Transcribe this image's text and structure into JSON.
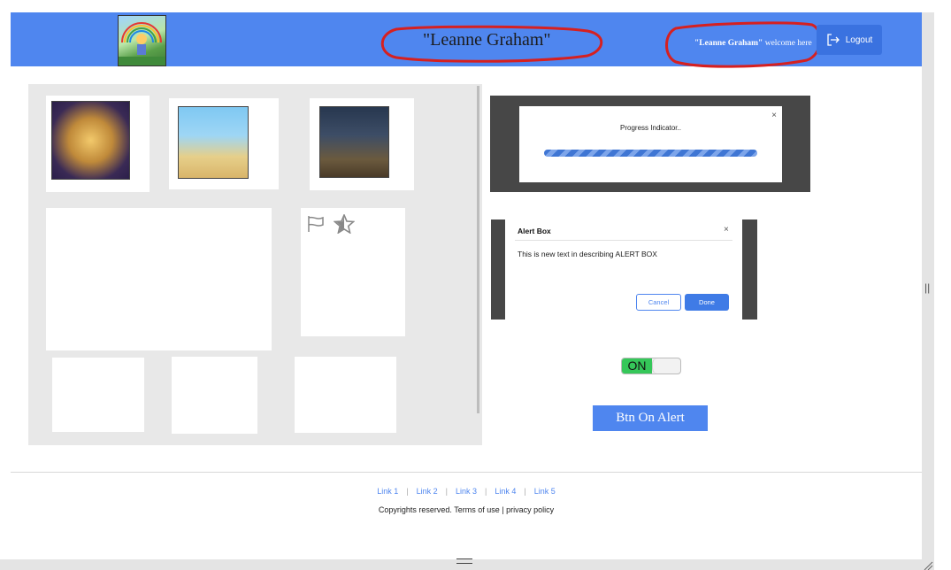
{
  "header": {
    "title": "\"Leanne Graham\"",
    "welcome_name": "\"Leanne Graham\"",
    "welcome_suffix": " welcome here",
    "logout_label": "Logout",
    "colors": {
      "bar": "#4f86ef",
      "button": "#3a72e0"
    }
  },
  "progress": {
    "label": "Progress Indicator..",
    "close": "×"
  },
  "alert": {
    "title": "Alert Box",
    "close": "×",
    "text": "This is new text in describing ALERT BOX",
    "cancel_label": "Cancel",
    "done_label": "Done"
  },
  "toggle": {
    "label": "ON",
    "state": "on",
    "color": "#35c759"
  },
  "alert_button": {
    "label": "Btn On Alert"
  },
  "footer": {
    "links": [
      "Link 1",
      "Link 2",
      "Link 3",
      "Link 4",
      "Link 5"
    ],
    "copyright": "Copyrights reserved. Terms of use | privacy policy"
  },
  "icons": {
    "logout": "logout-arrow-icon",
    "flag": "flag-icon",
    "star": "star-icon"
  }
}
